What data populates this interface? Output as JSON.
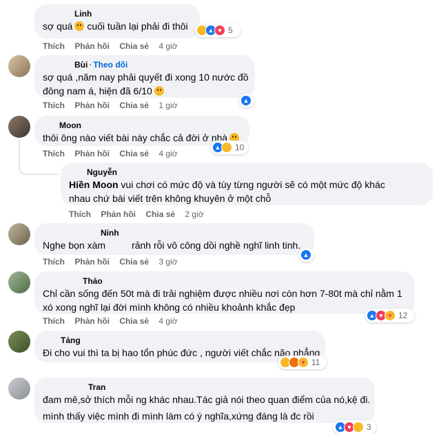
{
  "comments": [
    {
      "name": "Linh",
      "text": "sợ quá",
      "text_after_emoji": "cuối tuần lại phải đi thôi",
      "time": "4 giờ",
      "reaction_count": "5"
    },
    {
      "name": "Bùi",
      "follow": "Theo dõi",
      "lines": [
        "sợ quá ,năm nay phải quyết đi xong 10 nước đồ",
        "đông nam á, hiện đã 6/10"
      ],
      "time": "1 giờ"
    },
    {
      "name": "Moon",
      "text": "thôi ông nào viết bài này chắc cả đời ở nhà",
      "time": "4 giờ",
      "reaction_count": "10"
    },
    {
      "name": "Nguyễn",
      "mention": "Hiền Moon",
      "lines": [
        " vui chơi có mức độ và tùy từng người sẽ có một mức độ khác",
        "nhau chứ bài viết trên không khuyên ở một chỗ"
      ],
      "time": "2 giờ"
    },
    {
      "name": "Ninh",
      "text_before": "Nghe bọn xàm",
      "text_after": "rảnh rỗi vô công dồi nghề nghĩ linh tinh.",
      "time": "3 giờ"
    },
    {
      "name": "Thảo",
      "lines": [
        "Chỉ cần sống đến 50t mà đi trải nghiệm được nhiều nơi còn hơn 7-80t mà chỉ nằm 1",
        "xó xong nghĩ lại đời mình không có nhiều khoảnh khắc đẹp"
      ],
      "time": "4 giờ",
      "reaction_count": "12"
    },
    {
      "name": "Tảng",
      "text": "Đi cho vui thì ta bị hao tổn phúc đức , người viết chắc não phẳng",
      "time": "4 giờ",
      "reaction_count": "11"
    },
    {
      "name": "Tran",
      "lines": [
        "đam mê,sở thích mỗi ng khác nhau.Tác giả nói theo quan điểm của nó,kệ đi.",
        "mình thấy việc mình đi mình làm có ý nghĩa,xứng đáng là đc rồi"
      ],
      "reaction_count": "3"
    }
  ],
  "actions": {
    "like": "Thích",
    "reply": "Phản hồi",
    "share": "Chia sẻ"
  },
  "colors": {
    "bubble": "#f0f2f5",
    "like_blue": "#1877f2",
    "follow_blue": "#0064d1",
    "meta_gray": "#65676b"
  }
}
